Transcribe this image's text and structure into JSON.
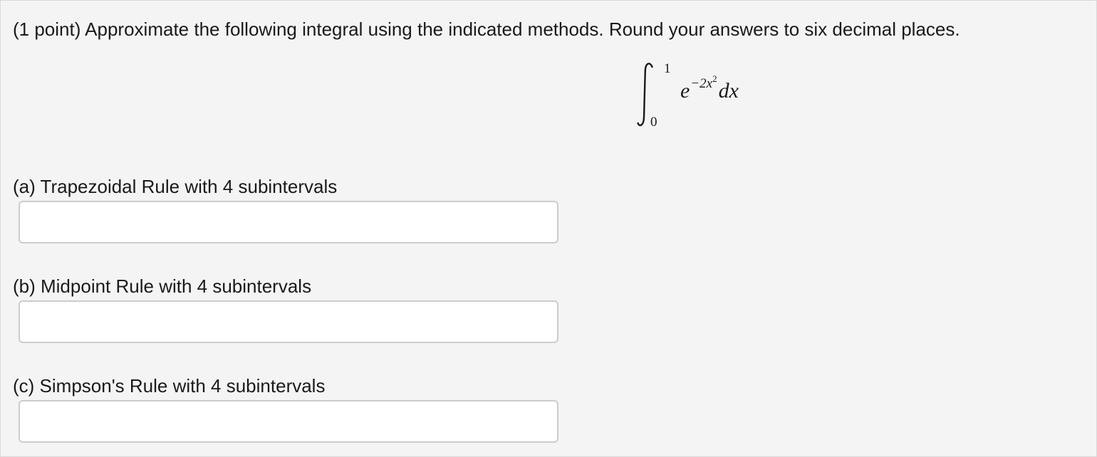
{
  "problem": {
    "intro": "(1 point) Approximate the following integral using the indicated methods. Round your answers to six decimal places.",
    "integral": {
      "lower_bound": "0",
      "upper_bound": "1",
      "base": "e",
      "exponent": "−2x",
      "exponent_power": "2",
      "differential": "dx"
    },
    "parts": [
      {
        "label": "(a) Trapezoidal Rule with 4 subintervals",
        "value": "",
        "placeholder": ""
      },
      {
        "label": "(b) Midpoint Rule with 4 subintervals",
        "value": "",
        "placeholder": ""
      },
      {
        "label": "(c) Simpson's Rule with 4 subintervals",
        "value": "",
        "placeholder": ""
      }
    ]
  },
  "colors": {
    "panel_background": "#f4f4f4",
    "panel_border": "#d9d9d9",
    "input_border": "#cccccc",
    "text": "#1a1a1a"
  }
}
